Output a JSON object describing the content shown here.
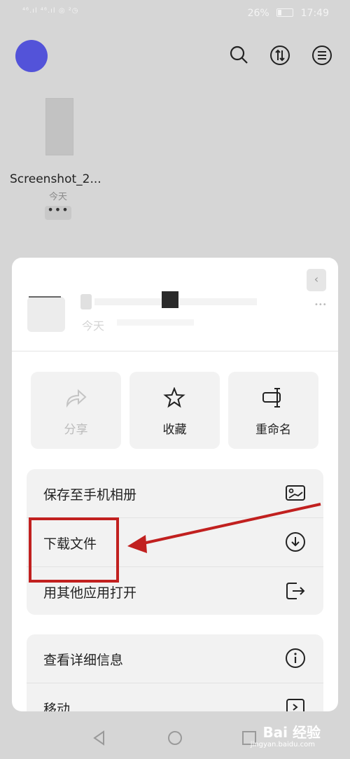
{
  "status_bar": {
    "network": "⁴⁶.ıl ⁴⁶.ıl ◎ ²◷",
    "battery": "26%",
    "time": "17:49"
  },
  "file": {
    "name": "Screenshot_2...",
    "date": "今天",
    "more": "•••"
  },
  "sheet": {
    "date": "今天",
    "actions": [
      {
        "label": "分享",
        "icon": "share-icon",
        "enabled": false
      },
      {
        "label": "收藏",
        "icon": "star-icon",
        "enabled": true
      },
      {
        "label": "重命名",
        "icon": "rename-icon",
        "enabled": true
      }
    ],
    "list1": [
      {
        "label": "保存至手机相册",
        "icon": "gallery-icon"
      },
      {
        "label": "下载文件",
        "icon": "download-icon"
      },
      {
        "label": "用其他应用打开",
        "icon": "open-with-icon"
      }
    ],
    "list2": [
      {
        "label": "查看详细信息",
        "icon": "info-icon"
      },
      {
        "label": "移动",
        "icon": "move-icon"
      }
    ]
  },
  "annotation": {
    "highlight_color": "#c1201f"
  },
  "watermark": {
    "brand": "Bai 经验",
    "url": "jingyan.baidu.com"
  },
  "colors": {
    "avatar": "#5353d9",
    "sheet_bg": "#ffffff",
    "overlay": "#d6d6d6"
  }
}
